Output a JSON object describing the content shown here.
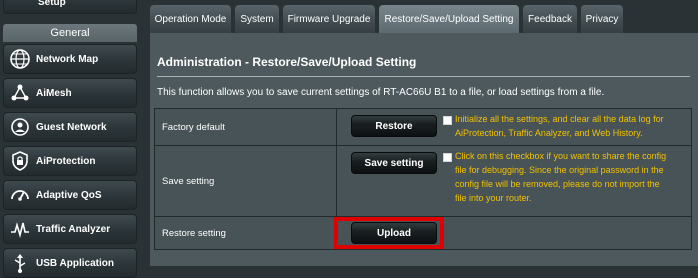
{
  "sidebar": {
    "top_partial": "Setup",
    "section_header": "General",
    "items": [
      {
        "label": "Network Map",
        "icon": "network-map-icon"
      },
      {
        "label": "AiMesh",
        "icon": "aimesh-icon"
      },
      {
        "label": "Guest Network",
        "icon": "guest-network-icon"
      },
      {
        "label": "AiProtection",
        "icon": "aiprotection-icon"
      },
      {
        "label": "Adaptive QoS",
        "icon": "adaptive-qos-icon"
      },
      {
        "label": "Traffic Analyzer",
        "icon": "traffic-analyzer-icon"
      },
      {
        "label": "USB Application",
        "icon": "usb-application-icon"
      }
    ]
  },
  "tabs": [
    {
      "label": "Operation Mode"
    },
    {
      "label": "System"
    },
    {
      "label": "Firmware Upgrade"
    },
    {
      "label": "Restore/Save/Upload Setting",
      "active": true
    },
    {
      "label": "Feedback"
    },
    {
      "label": "Privacy"
    }
  ],
  "page": {
    "title": "Administration - Restore/Save/Upload Setting",
    "description": "This function allows you to save current settings of RT-AC66U B1 to a file, or load settings from a file."
  },
  "rows": {
    "factory": {
      "label": "Factory default",
      "button": "Restore",
      "checkbox_note": "Initialize all the settings, and clear all the data log for AiProtection, Traffic Analyzer, and Web History."
    },
    "save": {
      "label": "Save setting",
      "button": "Save setting",
      "checkbox_note": "Click on this checkbox if you want to share the config file for debugging. Since the original password in the config file will be removed, please do not import the file into your router."
    },
    "restore": {
      "label": "Restore setting",
      "button": "Upload"
    }
  },
  "colors": {
    "note_text": "#f2c200",
    "highlight_border": "#e00000",
    "panel_bg": "#4d595d"
  }
}
